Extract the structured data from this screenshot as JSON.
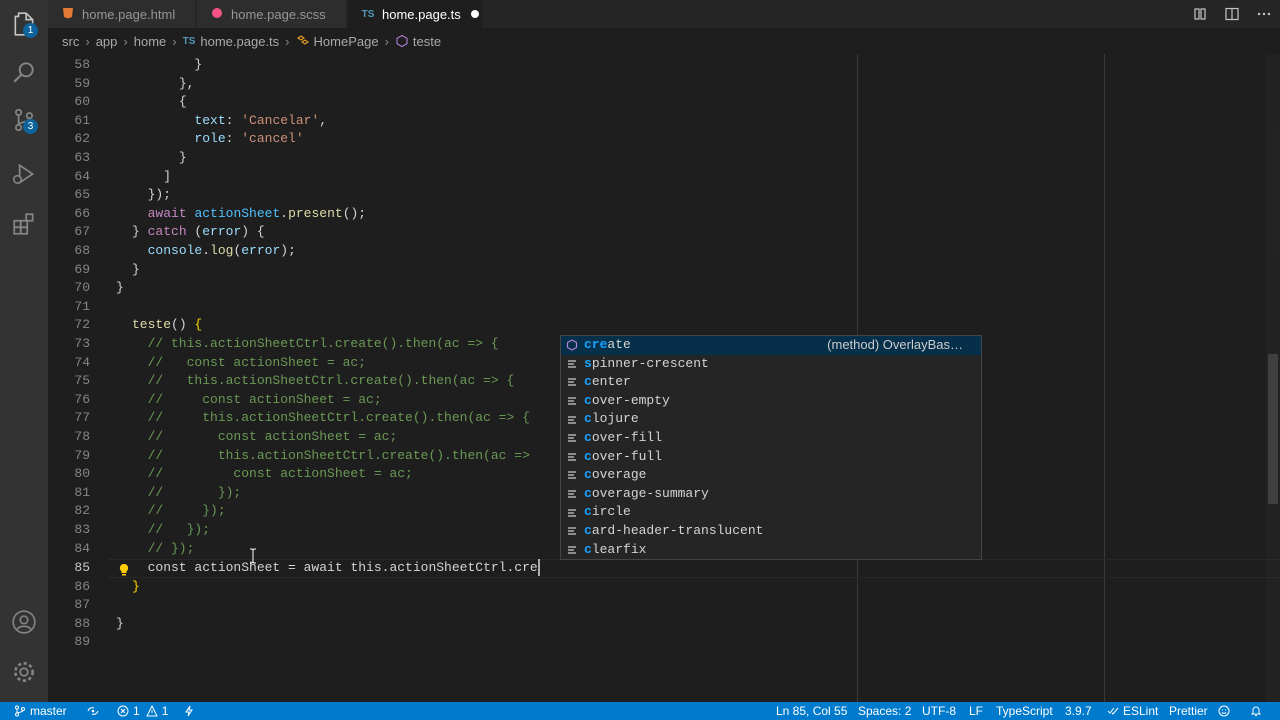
{
  "tabs": [
    {
      "label": "home.page.html",
      "icon": "html-file-icon",
      "active": false
    },
    {
      "label": "home.page.scss",
      "icon": "scss-file-icon",
      "active": false
    },
    {
      "label": "home.page.ts",
      "icon_text": "TS",
      "active": true,
      "modified": true
    }
  ],
  "breadcrumb": {
    "p1": "src",
    "p2": "app",
    "p3": "home",
    "file_icon": "TS",
    "p4": "home.page.ts",
    "p5": "HomePage",
    "p6": "teste"
  },
  "activity": {
    "explorer_badge": "1",
    "scm_badge": "3"
  },
  "editor": {
    "line_numbers": [
      "58",
      "59",
      "60",
      "61",
      "62",
      "63",
      "64",
      "65",
      "66",
      "67",
      "68",
      "69",
      "70",
      "71",
      "72",
      "73",
      "74",
      "75",
      "76",
      "77",
      "78",
      "79",
      "80",
      "81",
      "82",
      "83",
      "84",
      "85",
      "86",
      "87",
      "88",
      "89"
    ],
    "current_line": "85",
    "typed_text": "const actionSheet = await this.actionSheetCtrl.cre"
  },
  "suggest": {
    "items": [
      {
        "hl": "cre",
        "rest": "ate",
        "detail": "(method) OverlayBas…",
        "selected": true
      },
      {
        "hl": "",
        "label": "spinner-crescent"
      },
      {
        "hl": "",
        "label": "center"
      },
      {
        "hl": "",
        "label": "cover-empty"
      },
      {
        "hl": "",
        "label": "clojure"
      },
      {
        "hl": "",
        "label": "cover-fill"
      },
      {
        "hl": "",
        "label": "cover-full"
      },
      {
        "hl": "",
        "label": "coverage"
      },
      {
        "hl": "",
        "label": "coverage-summary"
      },
      {
        "hl": "",
        "label": "circle"
      },
      {
        "hl": "",
        "label": "card-header-translucent"
      },
      {
        "hl": "",
        "label": "clearfix"
      }
    ]
  },
  "status": {
    "branch": "master",
    "errors": "1",
    "warnings": "1",
    "position": "Ln 85, Col 55",
    "spaces": "Spaces: 2",
    "encoding": "UTF-8",
    "eol": "LF",
    "language": "TypeScript",
    "version": "3.9.7",
    "eslint": "ESLint",
    "prettier": "Prettier"
  },
  "colors": {
    "accent": "#007acc",
    "editor_bg": "#1e1e1e",
    "suggest_highlight": "#18a3ff"
  }
}
